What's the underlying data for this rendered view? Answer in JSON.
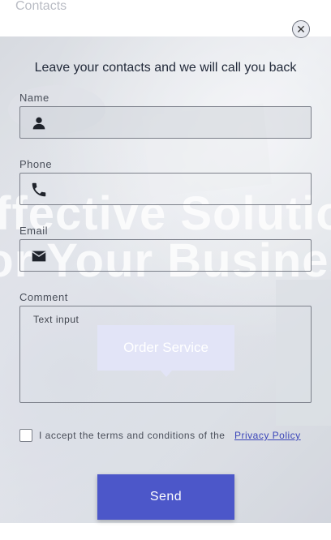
{
  "topbar": {
    "title": "Contacts"
  },
  "hero": {
    "headline_line1": "ffective Solutio",
    "headline_line2": "or Your Busines",
    "order_button": "Order Service"
  },
  "modal": {
    "heading": "Leave your contacts and we will call you back",
    "close_icon": "close-icon",
    "fields": {
      "name": {
        "label": "Name",
        "value": "",
        "icon": "person-icon"
      },
      "phone": {
        "label": "Phone",
        "value": "",
        "icon": "phone-icon"
      },
      "email": {
        "label": "Email",
        "value": "",
        "icon": "mail-icon"
      },
      "comment": {
        "label": "Comment",
        "placeholder": "Text input"
      }
    },
    "terms_text": "I accept the terms and conditions of the",
    "policy_link": "Privacy Policy",
    "terms_checked": false,
    "send_button": "Send"
  },
  "colors": {
    "accent": "#4c57c9",
    "link": "#3b46b8",
    "border": "#7c808a"
  }
}
